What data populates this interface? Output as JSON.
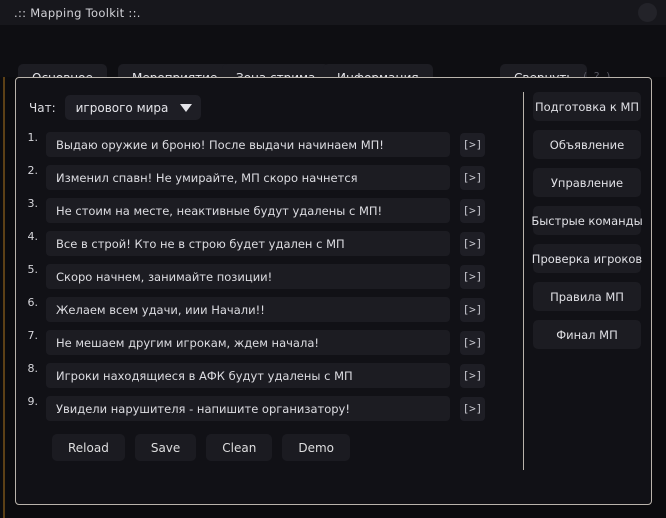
{
  "window": {
    "title": ".:: Mapping Toolkit ::.",
    "orb_icon": "status-orb"
  },
  "tabs": [
    {
      "label": "Основное"
    },
    {
      "label": "Мероприятие"
    },
    {
      "label": "Зона стрима"
    },
    {
      "label": "Информация"
    }
  ],
  "toolbar": {
    "minimize_label": "Свернуть",
    "help_label": "( ? )"
  },
  "chat": {
    "label": "Чат:",
    "selected": "игрового мира",
    "caret_icon": "chevron-down-icon"
  },
  "messages": [
    {
      "index": "1.",
      "text": "Выдаю оружие и броню! После выдачи начинаем МП!",
      "send": "[>]"
    },
    {
      "index": "2.",
      "text": "Изменил спавн! Не умирайте, МП скоро начнется",
      "send": "[>]"
    },
    {
      "index": "3.",
      "text": "Не стоим на месте, неактивные будут удалены с МП!",
      "send": "[>]"
    },
    {
      "index": "4.",
      "text": "Все в строй! Кто не в строю будет удален с МП",
      "send": "[>]"
    },
    {
      "index": "5.",
      "text": "Скоро начнем, занимайте позиции!",
      "send": "[>]"
    },
    {
      "index": "6.",
      "text": "Желаем всем удачи, иии Начали!!",
      "send": "[>]"
    },
    {
      "index": "7.",
      "text": "Не мешаем другим игрокам, ждем начала!",
      "send": "[>]"
    },
    {
      "index": "8.",
      "text": "Игроки находящиеся в АФК будут удалены с МП",
      "send": "[>]"
    },
    {
      "index": "9.",
      "text": "Увидели нарушителя - напишите организатору!",
      "send": "[>]"
    }
  ],
  "actions": [
    {
      "label": "Reload"
    },
    {
      "label": "Save"
    },
    {
      "label": "Clean"
    },
    {
      "label": "Demo"
    }
  ],
  "presets": [
    {
      "label": "Подготовка к МП"
    },
    {
      "label": "Объявление"
    },
    {
      "label": "Управление"
    },
    {
      "label": "Быстрые команды"
    },
    {
      "label": "Проверка игроков"
    },
    {
      "label": "Правила МП"
    },
    {
      "label": "Финал МП"
    }
  ],
  "colors": {
    "background": "#0b0b0e",
    "panel": "#111116",
    "control": "#1c1c22",
    "border": "#b9b3ab",
    "accent": "#6b4a17",
    "text": "#dddde2"
  }
}
